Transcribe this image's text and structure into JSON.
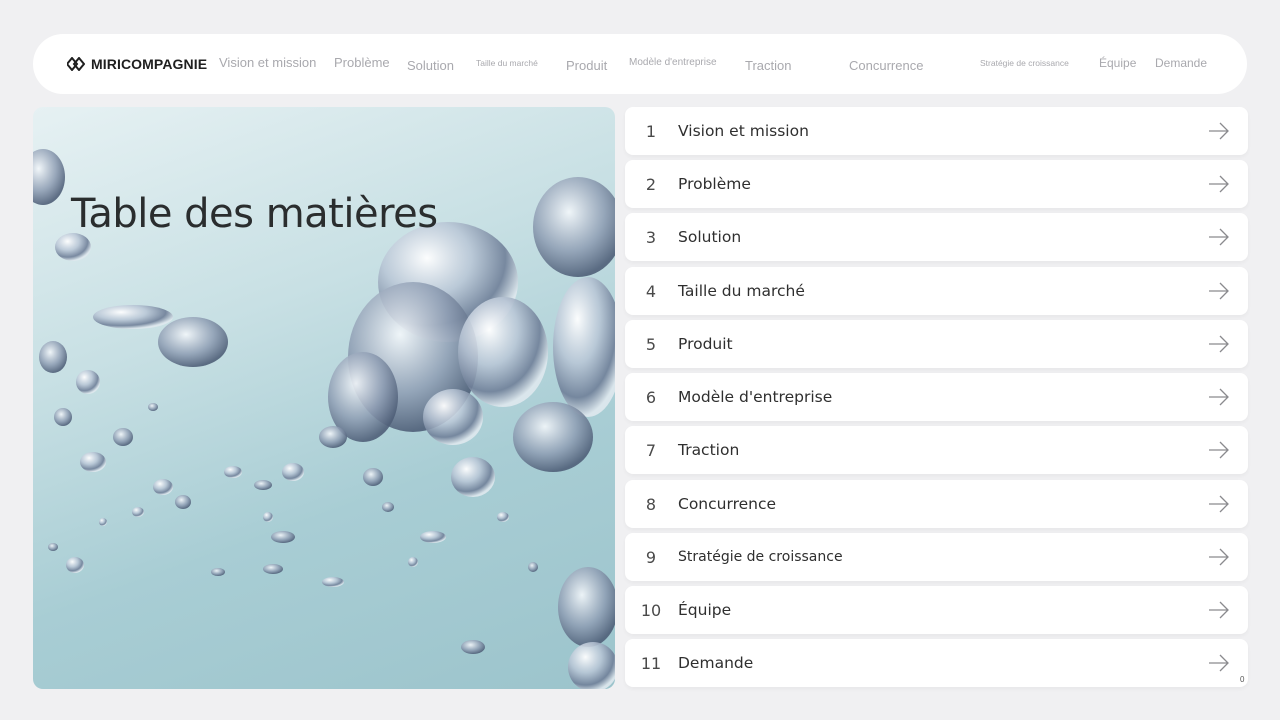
{
  "brand": {
    "name": "MIRICOMPAGNIE",
    "logo_icon": "linked-diamonds-icon"
  },
  "nav": {
    "items": [
      "Vision et mission",
      "Problème",
      "Solution",
      "Taille du marché",
      "Produit",
      "Modèle d'entreprise",
      "Traction",
      "Concurrence",
      "Stratégie de croissance",
      "Équipe",
      "Demande"
    ]
  },
  "hero": {
    "title": "Table des matières",
    "image": "water-bubbles-photo"
  },
  "toc": {
    "arrow_icon": "arrow-right-icon",
    "items": [
      {
        "number": "1",
        "label": "Vision et mission"
      },
      {
        "number": "2",
        "label": "Problème"
      },
      {
        "number": "3",
        "label": "Solution"
      },
      {
        "number": "4",
        "label": "Taille du marché"
      },
      {
        "number": "5",
        "label": "Produit"
      },
      {
        "number": "6",
        "label": "Modèle d'entreprise"
      },
      {
        "number": "7",
        "label": "Traction"
      },
      {
        "number": "8",
        "label": "Concurrence"
      },
      {
        "number": "9",
        "label": "Stratégie de croissance"
      },
      {
        "number": "10",
        "label": "Équipe"
      },
      {
        "number": "11",
        "label": "Demande"
      }
    ]
  },
  "page_number": "0",
  "colors": {
    "background": "#f0f0f2",
    "card": "#ffffff",
    "nav_text": "#a9a9ae",
    "text": "#2b2b2b",
    "water": "#a8cdd4"
  }
}
